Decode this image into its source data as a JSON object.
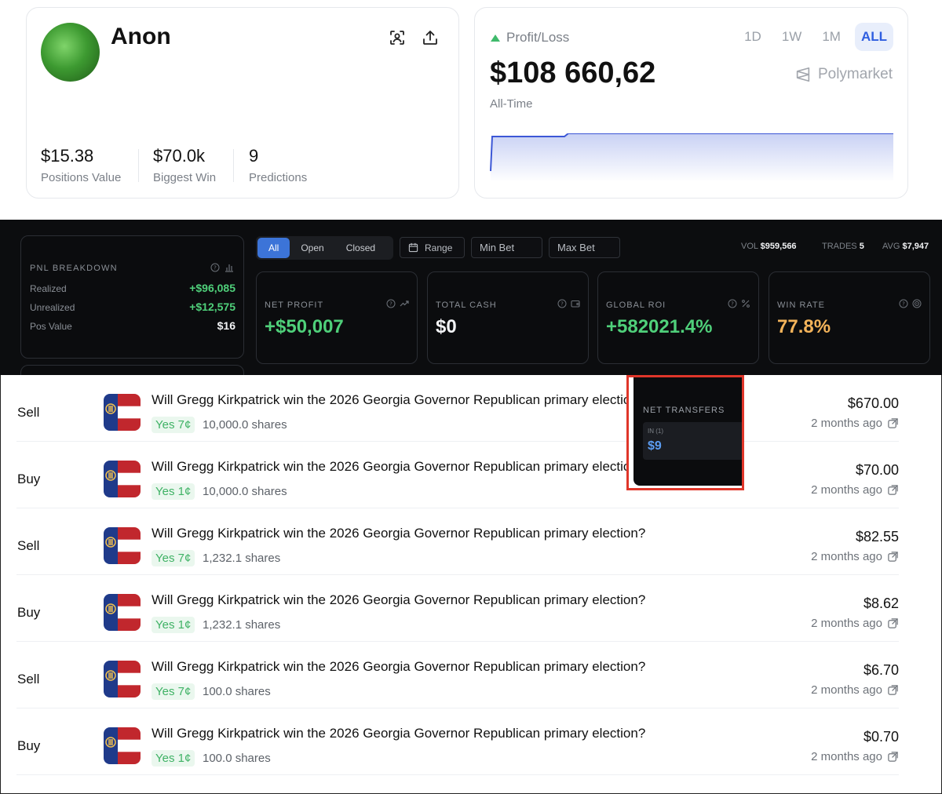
{
  "profile": {
    "name": "Anon",
    "stats": [
      {
        "value": "$15.38",
        "label": "Positions Value"
      },
      {
        "value": "$70.0k",
        "label": "Biggest Win"
      },
      {
        "value": "9",
        "label": "Predictions"
      }
    ]
  },
  "pnl": {
    "header": "Profit/Loss",
    "value": "$108 660,62",
    "period": "All-Time",
    "tabs": [
      "1D",
      "1W",
      "1M",
      "ALL"
    ],
    "active_tab": "ALL",
    "brand": "Polymarket",
    "accent_color": "#2f5ee0",
    "up_color": "#3fba6b"
  },
  "filters": {
    "buttons": [
      "All",
      "Open",
      "Closed"
    ],
    "active": "All",
    "range_label": "Range",
    "min_bet_placeholder": "Min Bet",
    "max_bet_placeholder": "Max Bet"
  },
  "meta": {
    "vol_label": "VOL",
    "vol_value": "$959,566",
    "trades_label": "TRADES",
    "trades_value": "5",
    "avg_label": "AVG",
    "avg_value": "$7,947"
  },
  "breakdown": {
    "title": "PNL BREAKDOWN",
    "rows": [
      {
        "label": "Realized",
        "value": "+$96,085"
      },
      {
        "label": "Unrealized",
        "value": "+$12,575"
      },
      {
        "label": "Pos Value",
        "value": "$16"
      }
    ]
  },
  "metrics": [
    {
      "title": "NET PROFIT",
      "value": "+$50,007",
      "color": "#4fd07a"
    },
    {
      "title": "TOTAL CASH",
      "value": "$0",
      "color": "#f2f3f5"
    },
    {
      "title": "GLOBAL ROI",
      "value": "+582021.4%",
      "color": "#4fd07a"
    },
    {
      "title": "WIN RATE",
      "value": "77.8%",
      "color": "#f3b35a"
    }
  ],
  "net_transfers": {
    "title": "NET TRANSFERS",
    "in_label": "IN (1)",
    "in_value": "$9",
    "highlight_color": "#e0362a"
  },
  "trades": [
    {
      "side": "Sell",
      "question": "Will Gregg Kirkpatrick win the 2026 Georgia Governor Republican primary election?",
      "outcome": "Yes 7¢",
      "shares": "10,000.0 shares",
      "amount": "$670.00",
      "time": "2 months ago"
    },
    {
      "side": "Buy",
      "question": "Will Gregg Kirkpatrick win the 2026 Georgia Governor Republican primary election?",
      "outcome": "Yes 1¢",
      "shares": "10,000.0 shares",
      "amount": "$70.00",
      "time": "2 months ago"
    },
    {
      "side": "Sell",
      "question": "Will Gregg Kirkpatrick win the 2026 Georgia Governor Republican primary election?",
      "outcome": "Yes 7¢",
      "shares": "1,232.1 shares",
      "amount": "$82.55",
      "time": "2 months ago"
    },
    {
      "side": "Buy",
      "question": "Will Gregg Kirkpatrick win the 2026 Georgia Governor Republican primary election?",
      "outcome": "Yes 1¢",
      "shares": "1,232.1 shares",
      "amount": "$8.62",
      "time": "2 months ago"
    },
    {
      "side": "Sell",
      "question": "Will Gregg Kirkpatrick win the 2026 Georgia Governor Republican primary election?",
      "outcome": "Yes 7¢",
      "shares": "100.0 shares",
      "amount": "$6.70",
      "time": "2 months ago"
    },
    {
      "side": "Buy",
      "question": "Will Gregg Kirkpatrick win the 2026 Georgia Governor Republican primary election?",
      "outcome": "Yes 1¢",
      "shares": "100.0 shares",
      "amount": "$0.70",
      "time": "2 months ago"
    }
  ]
}
